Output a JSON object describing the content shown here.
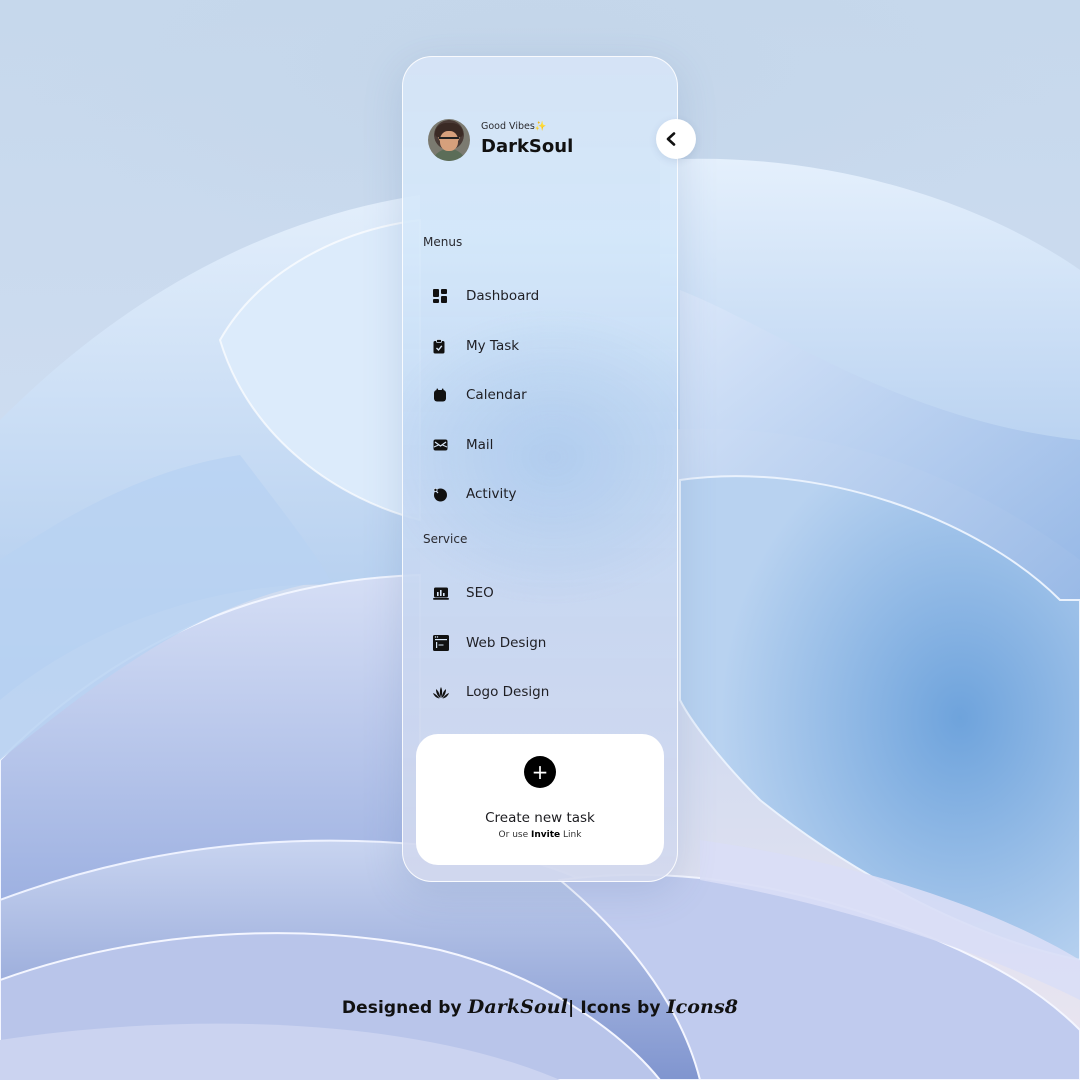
{
  "profile": {
    "greeting": "Good Vibes",
    "greeting_emoji": "✨",
    "name": "DarkSoul",
    "avatar_icon": "avatar"
  },
  "collapse_button": {
    "icon": "chevron-left-icon"
  },
  "menus": {
    "title": "Menus",
    "items": [
      {
        "label": "Dashboard",
        "icon": "dashboard-icon"
      },
      {
        "label": "My Task",
        "icon": "clipboard-task-icon"
      },
      {
        "label": "Calendar",
        "icon": "calendar-icon"
      },
      {
        "label": "Mail",
        "icon": "mail-icon"
      },
      {
        "label": "Activity",
        "icon": "activity-icon"
      }
    ]
  },
  "service": {
    "title": "Service",
    "items": [
      {
        "label": "SEO",
        "icon": "seo-chart-icon"
      },
      {
        "label": "Web Design",
        "icon": "web-design-icon"
      },
      {
        "label": "Logo Design",
        "icon": "logo-design-icon"
      }
    ]
  },
  "create": {
    "plus": "+",
    "title": "Create new task",
    "sub_prefix": "Or use",
    "sub_bold": "Invite",
    "sub_suffix": "Link"
  },
  "footer": {
    "designed_by": "Designed by",
    "designer": "DarkSoul",
    "separator": "|",
    "icons_by": "Icons by",
    "icons_source": "Icons8"
  },
  "colors": {
    "background": "#c9d9ec",
    "card_surface": "#d6e4f6",
    "accent_black": "#000000",
    "create_box": "#ffffff",
    "sparkle": "#f3b61f"
  }
}
